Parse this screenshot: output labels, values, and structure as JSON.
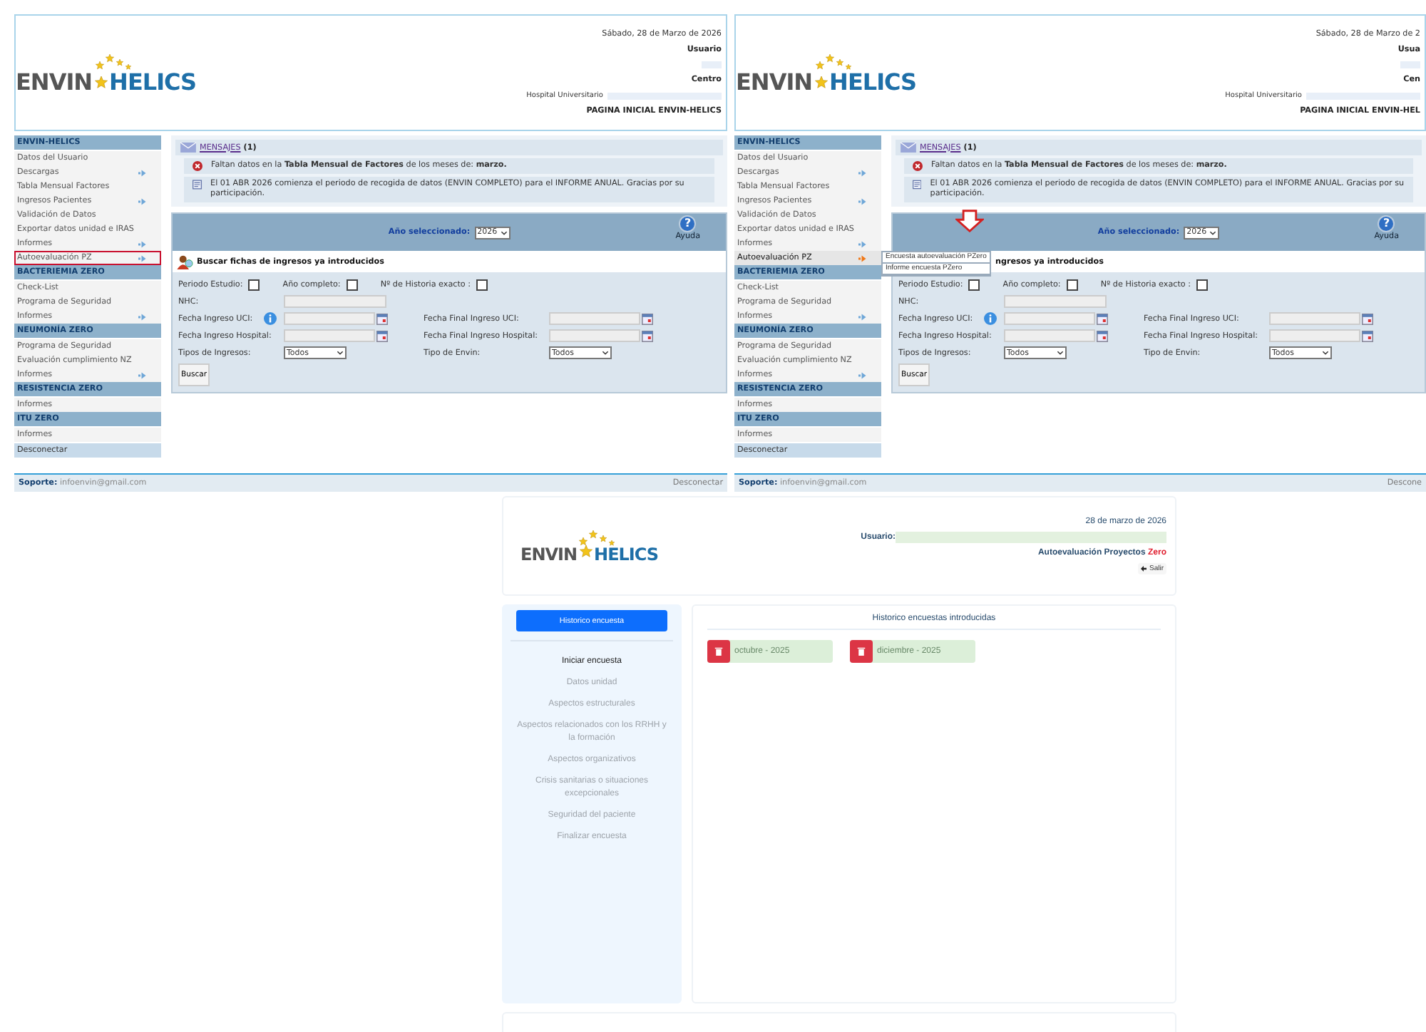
{
  "legacy_screens": [
    {
      "logo": {
        "left": "ENVIN",
        "right": "HELICS"
      },
      "header": {
        "date": "Sábado, 28 de Marzo de 2026",
        "user_label": "Usuario",
        "center_label": "Centro",
        "hospital": "Hospital Universitario",
        "page_title": "PAGINA INICIAL ENVIN-HELICS"
      },
      "sidebar": [
        {
          "kind": "header",
          "label": "ENVIN-HELICS"
        },
        {
          "kind": "item",
          "label": "Datos del Usuario",
          "arrow": false,
          "outlined": false,
          "open": false
        },
        {
          "kind": "item",
          "label": "Descargas",
          "arrow": true,
          "outlined": false,
          "open": false
        },
        {
          "kind": "item",
          "label": "Tabla Mensual Factores",
          "arrow": false,
          "outlined": false,
          "open": false
        },
        {
          "kind": "item",
          "label": "Ingresos Pacientes",
          "arrow": true,
          "outlined": false,
          "open": false
        },
        {
          "kind": "item",
          "label": "Validación de Datos",
          "arrow": false,
          "outlined": false,
          "open": false
        },
        {
          "kind": "item",
          "label": "Exportar datos unidad e IRAS",
          "arrow": false,
          "outlined": false,
          "open": false
        },
        {
          "kind": "item",
          "label": "Informes",
          "arrow": true,
          "outlined": false,
          "open": false
        },
        {
          "kind": "item",
          "label": "Autoevaluación PZ",
          "arrow": true,
          "outlined": true,
          "open": false
        },
        {
          "kind": "header",
          "label": "BACTERIEMIA ZERO"
        },
        {
          "kind": "item",
          "label": "Check-List",
          "arrow": false,
          "outlined": false,
          "open": false
        },
        {
          "kind": "item",
          "label": "Programa de Seguridad",
          "arrow": false,
          "outlined": false,
          "open": false
        },
        {
          "kind": "item",
          "label": "Informes",
          "arrow": true,
          "outlined": false,
          "open": false
        },
        {
          "kind": "header",
          "label": "NEUMONÍA ZERO"
        },
        {
          "kind": "item",
          "label": "Programa de Seguridad",
          "arrow": false,
          "outlined": false,
          "open": false
        },
        {
          "kind": "item",
          "label": "Evaluación cumplimiento NZ",
          "arrow": false,
          "outlined": false,
          "open": false
        },
        {
          "kind": "item",
          "label": "Informes",
          "arrow": true,
          "outlined": false,
          "open": false
        },
        {
          "kind": "header",
          "label": "RESISTENCIA ZERO"
        },
        {
          "kind": "item",
          "label": "Informes",
          "arrow": false,
          "outlined": false,
          "open": false
        },
        {
          "kind": "header",
          "label": "ITU ZERO"
        },
        {
          "kind": "item",
          "label": "Informes",
          "arrow": false,
          "outlined": false,
          "open": false
        },
        {
          "kind": "logout",
          "label": "Desconectar"
        }
      ],
      "messages": {
        "link": "MENSAJES",
        "count": "(1)",
        "items": [
          {
            "kind": "error",
            "text": "Faltan datos en la **Tabla Mensual de Factores** de los meses de: **marzo.**"
          },
          {
            "kind": "notice",
            "text": "El 01 ABR 2026 comienza el periodo de recogida de datos (ENVIN COMPLETO) para el INFORME ANUAL. Gracias por su participación."
          }
        ]
      },
      "search": {
        "year_label": "Año seleccionado:",
        "year": "2026",
        "help_symbol": "?",
        "help": "Ayuda",
        "title": "Buscar fichas de ingresos ya introducidos",
        "title_icon": true,
        "arrow_annotation": false,
        "checkboxes": [
          {
            "label": "Periodo Estudio:",
            "checked": false
          },
          {
            "label": "Año completo:",
            "checked": false
          },
          {
            "label": "Nº de Historia exacto :",
            "checked": false
          }
        ],
        "nhc": "NHC:",
        "dates": [
          {
            "label": "Fecha Ingreso UCI:",
            "info": true
          },
          {
            "label": "Fecha Final Ingreso UCI:",
            "info": false
          },
          {
            "label": "Fecha Ingreso Hospital:",
            "info": false
          },
          {
            "label": "Fecha Final Ingreso Hospital:",
            "info": false
          }
        ],
        "selects": [
          {
            "label": "Tipos de Ingresos:",
            "value": "Todos"
          },
          {
            "label": "Tipo de Envin:",
            "value": "Todos"
          }
        ],
        "button": "Buscar"
      },
      "footer": {
        "support": "**Soporte:** infoenvin@gmail.com",
        "logout": "Desconectar"
      }
    },
    {
      "logo": {
        "left": "ENVIN",
        "right": "HELICS"
      },
      "header": {
        "date": "Sábado, 28 de Marzo de 2",
        "user_label": "Usua",
        "center_label": "Cen",
        "hospital": "Hospital Universitario",
        "page_title": "PAGINA INICIAL ENVIN-HEL"
      },
      "sidebar": [
        {
          "kind": "header",
          "label": "ENVIN-HELICS"
        },
        {
          "kind": "item",
          "label": "Datos del Usuario",
          "arrow": false,
          "outlined": false,
          "open": false
        },
        {
          "kind": "item",
          "label": "Descargas",
          "arrow": true,
          "outlined": false,
          "open": false
        },
        {
          "kind": "item",
          "label": "Tabla Mensual Factores",
          "arrow": false,
          "outlined": false,
          "open": false
        },
        {
          "kind": "item",
          "label": "Ingresos Pacientes",
          "arrow": true,
          "outlined": false,
          "open": false
        },
        {
          "kind": "item",
          "label": "Validación de Datos",
          "arrow": false,
          "outlined": false,
          "open": false
        },
        {
          "kind": "item",
          "label": "Exportar datos unidad e IRAS",
          "arrow": false,
          "outlined": false,
          "open": false
        },
        {
          "kind": "item",
          "label": "Informes",
          "arrow": true,
          "outlined": false,
          "open": false
        },
        {
          "kind": "item",
          "label": "Autoevaluación PZ",
          "arrow": true,
          "outlined": false,
          "open": true,
          "submenu": [
            "Encuesta autoevaluación PZero",
            "Informe encuesta PZero"
          ]
        },
        {
          "kind": "header",
          "label": "BACTERIEMIA ZERO"
        },
        {
          "kind": "item",
          "label": "Check-List",
          "arrow": false,
          "outlined": false,
          "open": false
        },
        {
          "kind": "item",
          "label": "Programa de Seguridad",
          "arrow": false,
          "outlined": false,
          "open": false
        },
        {
          "kind": "item",
          "label": "Informes",
          "arrow": true,
          "outlined": false,
          "open": false
        },
        {
          "kind": "header",
          "label": "NEUMONÍA ZERO"
        },
        {
          "kind": "item",
          "label": "Programa de Seguridad",
          "arrow": false,
          "outlined": false,
          "open": false
        },
        {
          "kind": "item",
          "label": "Evaluación cumplimiento NZ",
          "arrow": false,
          "outlined": false,
          "open": false
        },
        {
          "kind": "item",
          "label": "Informes",
          "arrow": true,
          "outlined": false,
          "open": false
        },
        {
          "kind": "header",
          "label": "RESISTENCIA ZERO"
        },
        {
          "kind": "item",
          "label": "Informes",
          "arrow": false,
          "outlined": false,
          "open": false
        },
        {
          "kind": "header",
          "label": "ITU ZERO"
        },
        {
          "kind": "item",
          "label": "Informes",
          "arrow": false,
          "outlined": false,
          "open": false
        },
        {
          "kind": "logout",
          "label": "Desconectar"
        }
      ],
      "messages": {
        "link": "MENSAJES",
        "count": "(1)",
        "items": [
          {
            "kind": "error",
            "text": "Faltan datos en la **Tabla Mensual de Factores** de los meses de: **marzo.**"
          },
          {
            "kind": "notice",
            "text": "El 01 ABR 2026 comienza el periodo de recogida de datos (ENVIN COMPLETO) para el INFORME ANUAL. Gracias por su participación."
          }
        ]
      },
      "search": {
        "year_label": "Año seleccionado:",
        "year": "2026",
        "help_symbol": "?",
        "help": "Ayuda",
        "title": "ngresos ya introducidos",
        "title_icon": false,
        "arrow_annotation": true,
        "checkboxes": [
          {
            "label": "Periodo Estudio:",
            "checked": false
          },
          {
            "label": "Año completo:",
            "checked": false
          },
          {
            "label": "Nº de Historia exacto :",
            "checked": false
          }
        ],
        "nhc": "NHC:",
        "dates": [
          {
            "label": "Fecha Ingreso UCI:",
            "info": true
          },
          {
            "label": "Fecha Final Ingreso UCI:",
            "info": false
          },
          {
            "label": "Fecha Ingreso Hospital:",
            "info": false
          },
          {
            "label": "Fecha Final Ingreso Hospital:",
            "info": false
          }
        ],
        "selects": [
          {
            "label": "Tipos de Ingresos:",
            "value": "Todos"
          },
          {
            "label": "Tipo de Envin:",
            "value": "Todos"
          }
        ],
        "button": "Buscar"
      },
      "footer": {
        "support": "**Soporte:** infoenvin@gmail.com",
        "logout": "Descone"
      }
    }
  ],
  "survey_screen": {
    "logo": {
      "left": "ENVIN",
      "right": "HELICS"
    },
    "header": {
      "date": "28 de marzo de 2026",
      "user_label": "Usuario:",
      "app_title": "Autoevaluación Proyectos",
      "app_title_accent": "Zero",
      "logout": "Salir"
    },
    "sidebar": {
      "button": "Historico encuesta",
      "items": [
        {
          "label": "Iniciar encuesta",
          "disabled": false
        },
        {
          "label": "Datos unidad",
          "disabled": true
        },
        {
          "label": "Aspectos estructurales",
          "disabled": true
        },
        {
          "label": "Aspectos relacionados con los RRHH y la formación",
          "disabled": true
        },
        {
          "label": "Aspectos organizativos",
          "disabled": true
        },
        {
          "label": "Crisis sanitarias o situaciones excepcionales",
          "disabled": true
        },
        {
          "label": "Seguridad del paciente",
          "disabled": true
        },
        {
          "label": "Finalizar encuesta",
          "disabled": true
        }
      ]
    },
    "history": {
      "title": "Historico encuestas introducidas",
      "entries": [
        {
          "label": "octubre - 2025"
        },
        {
          "label": "diciembre - 2025"
        }
      ]
    }
  }
}
